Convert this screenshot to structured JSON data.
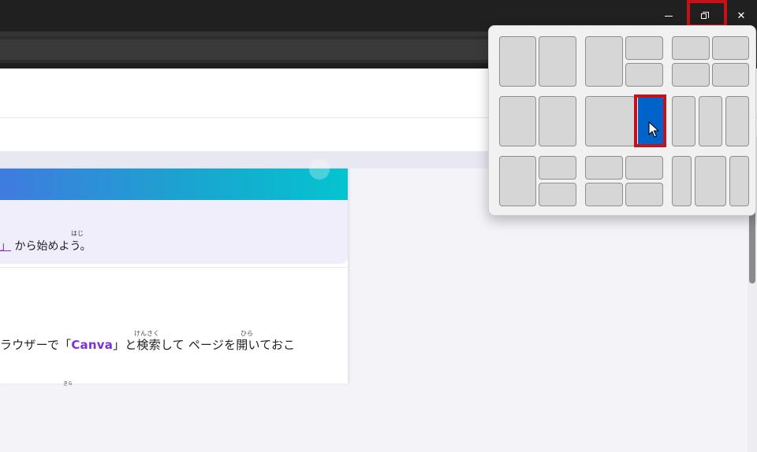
{
  "window": {
    "controls": {
      "minimize": "—",
      "restore": "❐",
      "close": "✕"
    }
  },
  "note": {
    "ruby": "はじ",
    "link_text": "」",
    "text": "から始めよう。"
  },
  "content": {
    "prefix": "ラウザーで「",
    "brand": "Canva",
    "suffix": "」と検索して ページを開いておこ",
    "ruby_search": "けんさく",
    "ruby_open": "ひら",
    "ruby_bottom": "きら"
  },
  "colors": {
    "titlebar": "#202020",
    "highlight": "#c4121a",
    "snap_active": "#0063c9",
    "brand_purple": "#7b2fe0"
  },
  "snap_layouts": {
    "layout_count": 6,
    "hovered_layout": 4,
    "hovered_zone": "right-zone"
  },
  "icons": [
    "minimize-icon",
    "restore-icon",
    "close-icon",
    "mouse-cursor-icon"
  ]
}
